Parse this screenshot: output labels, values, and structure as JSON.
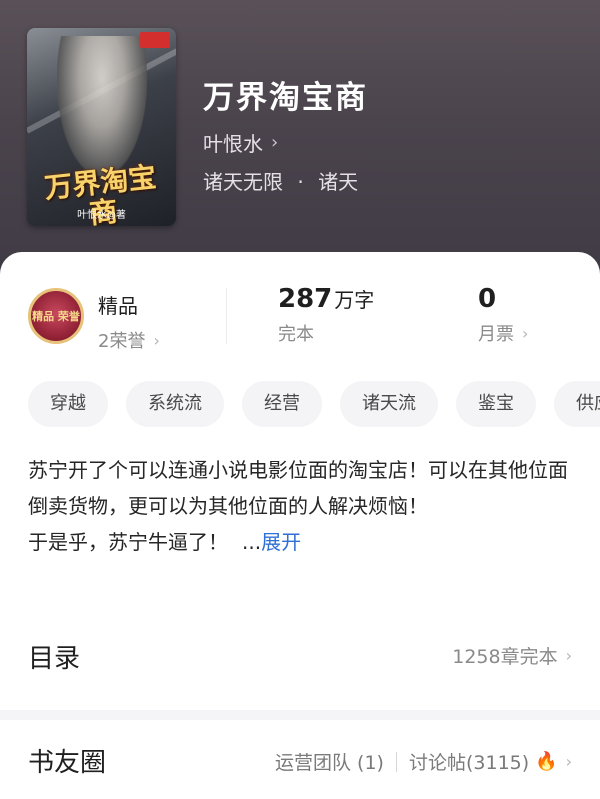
{
  "book": {
    "title": "万界淘宝商",
    "author": "叶恨水",
    "categories": [
      "诸天无限",
      "诸天"
    ],
    "category_separator": "·",
    "cover": {
      "title": "万界淘宝商",
      "author_line": "叶恨水◎著"
    }
  },
  "stats": {
    "quality": {
      "label": "精品",
      "honor": "2荣誉",
      "medal_text": "精品 荣誉"
    },
    "words": {
      "value": "287",
      "unit": "万字",
      "status": "完本"
    },
    "monthly_votes": {
      "value": "0",
      "label": "月票"
    }
  },
  "tags": [
    "穿越",
    "系统流",
    "经营",
    "诸天流",
    "鉴宝",
    "供应商"
  ],
  "description": {
    "text": "苏宁开了个可以连通小说电影位面的淘宝店！可以在其他位面倒卖货物，更可以为其他位面的人解决烦恼！",
    "line4": "于是乎，苏宁牛逼了！",
    "ellipsis": "...",
    "expand_label": "展开"
  },
  "toc": {
    "label": "目录",
    "summary": "1258章完本"
  },
  "reader_circle": {
    "label": "书友圈",
    "ops_team": "运营团队 (1)",
    "discussions": "讨论帖(3115)"
  },
  "icons": {
    "chevron": "chevron-right-icon",
    "flame": "flame-icon",
    "medal": "quality-medal-icon"
  },
  "colors": {
    "hero_bg": "#4a434c",
    "link": "#2f6fd6",
    "flame": "#e43b3b",
    "tag_bg": "#f4f4f6"
  }
}
